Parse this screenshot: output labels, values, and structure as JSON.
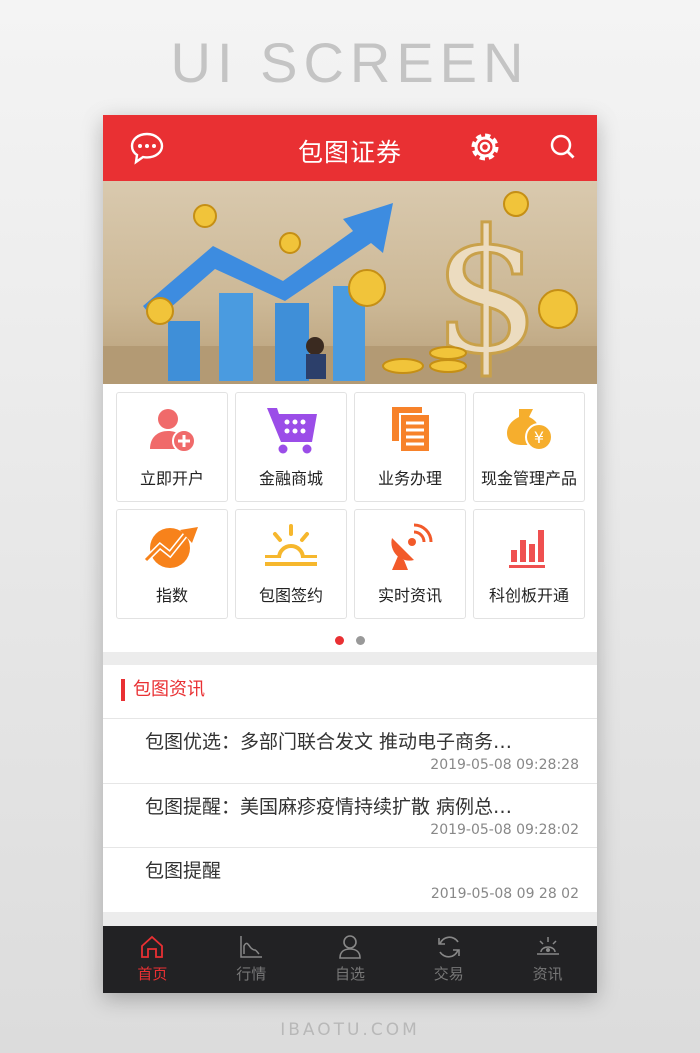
{
  "poster": {
    "heading": "UI SCREEN",
    "footer": "IBAOTU.COM"
  },
  "header": {
    "title": "包图证券",
    "icons": [
      "chat-icon",
      "gear-icon",
      "search-icon"
    ]
  },
  "grid": [
    {
      "label": "立即开户",
      "icon": "add-user-icon",
      "color": "#f06a6a"
    },
    {
      "label": "金融商城",
      "icon": "cart-icon",
      "color": "#9b4de8"
    },
    {
      "label": "业务办理",
      "icon": "document-icon",
      "color": "#f7822a"
    },
    {
      "label": "现金管理产品",
      "icon": "money-bag-icon",
      "color": "#f6ae2d"
    },
    {
      "label": "指数",
      "icon": "trend-icon",
      "color": "#f7821b"
    },
    {
      "label": "包图签约",
      "icon": "sunrise-icon",
      "color": "#f6b72d"
    },
    {
      "label": "实时资讯",
      "icon": "satellite-icon",
      "color": "#f25a2a"
    },
    {
      "label": "科创板开通",
      "icon": "bar-chart-icon",
      "color": "#ef5050"
    }
  ],
  "pager": {
    "pages": 2,
    "active": 1
  },
  "news": {
    "title": "包图资讯",
    "items": [
      {
        "title": "包图优选：多部门联合发文 推动电子商务…",
        "date": "2019-05-08 09:28:28"
      },
      {
        "title": "包图提醒：美国麻疹疫情持续扩散 病例总…",
        "date": "2019-05-08 09:28:02"
      },
      {
        "title": "包图提醒",
        "date": "2019-05-08 09 28 02"
      }
    ]
  },
  "tabs": [
    {
      "label": "首页",
      "icon": "home-icon",
      "active": true
    },
    {
      "label": "行情",
      "icon": "chart-icon"
    },
    {
      "label": "自选",
      "icon": "user-icon"
    },
    {
      "label": "交易",
      "icon": "refresh-icon"
    },
    {
      "label": "资讯",
      "icon": "eye-icon"
    }
  ],
  "colors": {
    "brand": "#e93033",
    "tabbar": "#222224"
  }
}
